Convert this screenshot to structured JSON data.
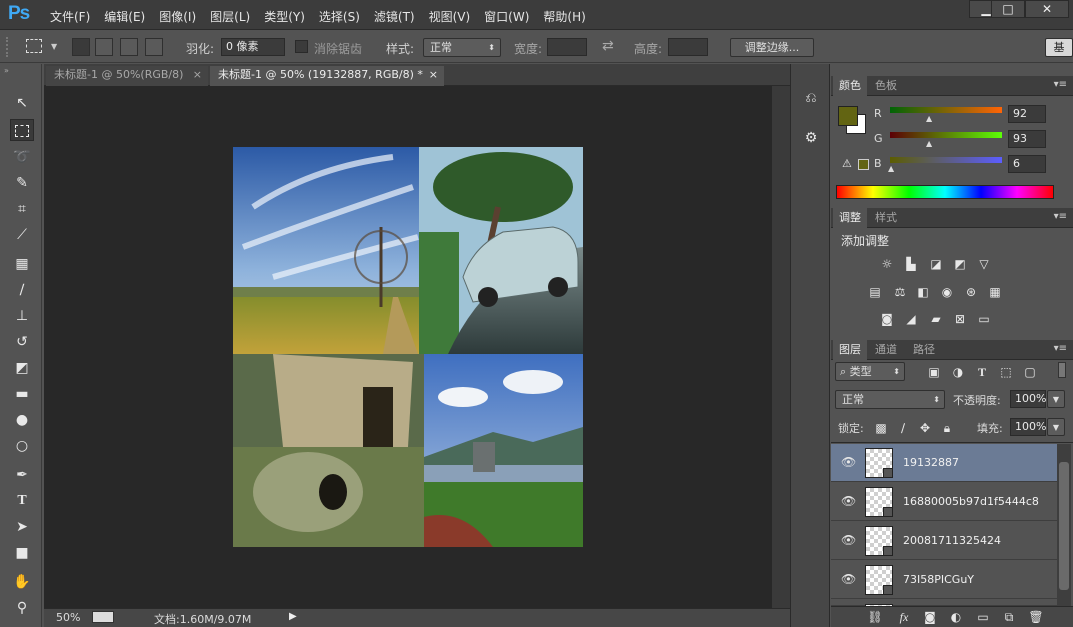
{
  "app": {
    "logo": "Ps",
    "menu": [
      "文件(F)",
      "编辑(E)",
      "图像(I)",
      "图层(L)",
      "类型(Y)",
      "选择(S)",
      "滤镜(T)",
      "视图(V)",
      "窗口(W)",
      "帮助(H)"
    ],
    "window_buttons": {
      "minimize": "▁",
      "maximize": "□",
      "close": "✕"
    }
  },
  "options": {
    "feather_label": "羽化:",
    "feather_value": "0 像素",
    "antialias_label": "消除锯齿",
    "style_label": "样式:",
    "style_value": "正常",
    "width_label": "宽度:",
    "height_label": "高度:",
    "refine_button": "调整边缘...",
    "workspace_button": "基"
  },
  "tabs": [
    {
      "label": "未标题-1 @ 50%(RGB/8)",
      "close": "×"
    },
    {
      "label": "未标题-1 @ 50% (19132887, RGB/8) *",
      "close": "×"
    }
  ],
  "status": {
    "zoom": "50%",
    "doc_info": "文档:1.60M/9.07M",
    "arrow": "▶"
  },
  "color_panel": {
    "tabs": [
      "颜色",
      "色板"
    ],
    "foreground_color": "#626412",
    "channels": [
      {
        "label": "R",
        "value": "92"
      },
      {
        "label": "G",
        "value": "93"
      },
      {
        "label": "B",
        "value": "6"
      }
    ]
  },
  "adjust_panel": {
    "tabs": [
      "调整",
      "样式"
    ],
    "title": "添加调整"
  },
  "layers_panel": {
    "tabs": [
      "图层",
      "通道",
      "路径"
    ],
    "filter_kind": "类型",
    "blend_mode": "正常",
    "opacity_label": "不透明度:",
    "opacity_value": "100%",
    "lock_label": "锁定:",
    "fill_label": "填充:",
    "fill_value": "100%",
    "layers": [
      {
        "name": "19132887",
        "selected": true
      },
      {
        "name": "16880005b97d1f5444c8",
        "selected": false
      },
      {
        "name": "20081711325424",
        "selected": false
      },
      {
        "name": "73I58PICGuY",
        "selected": false
      }
    ]
  },
  "colors": {
    "accent_ps": "#3fa9f5",
    "selected_layer": "#6b7b95",
    "panel_bg": "#535353",
    "canvas_bg": "#282828"
  }
}
